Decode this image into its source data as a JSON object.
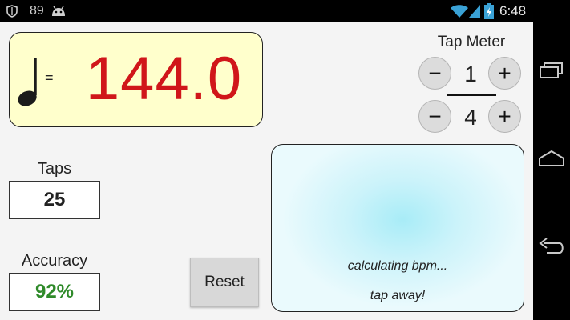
{
  "status_bar": {
    "notification_count": "89",
    "clock": "6:48",
    "icons": [
      "shield-icon",
      "android-icon",
      "wifi-icon",
      "signal-icon",
      "battery-charging-icon"
    ]
  },
  "tempo": {
    "note_icon": "quarter-note-icon",
    "equals": "=",
    "bpm": "144.0",
    "bpm_color": "#d0161a",
    "panel_color": "#ffffcc"
  },
  "tap_meter": {
    "label": "Tap Meter",
    "numerator": "1",
    "denominator": "4",
    "minus_label": "−",
    "plus_label": "+"
  },
  "taps": {
    "label": "Taps",
    "value": "25"
  },
  "accuracy": {
    "label": "Accuracy",
    "value": "92%",
    "color": "#2f8a2a"
  },
  "reset": {
    "label": "Reset"
  },
  "tap_area": {
    "line1": "calculating bpm...",
    "line2": "tap away!",
    "color": "#a8ecf7"
  },
  "nav_bar": {
    "icons": [
      "recent-apps-icon",
      "home-icon",
      "back-icon"
    ]
  }
}
